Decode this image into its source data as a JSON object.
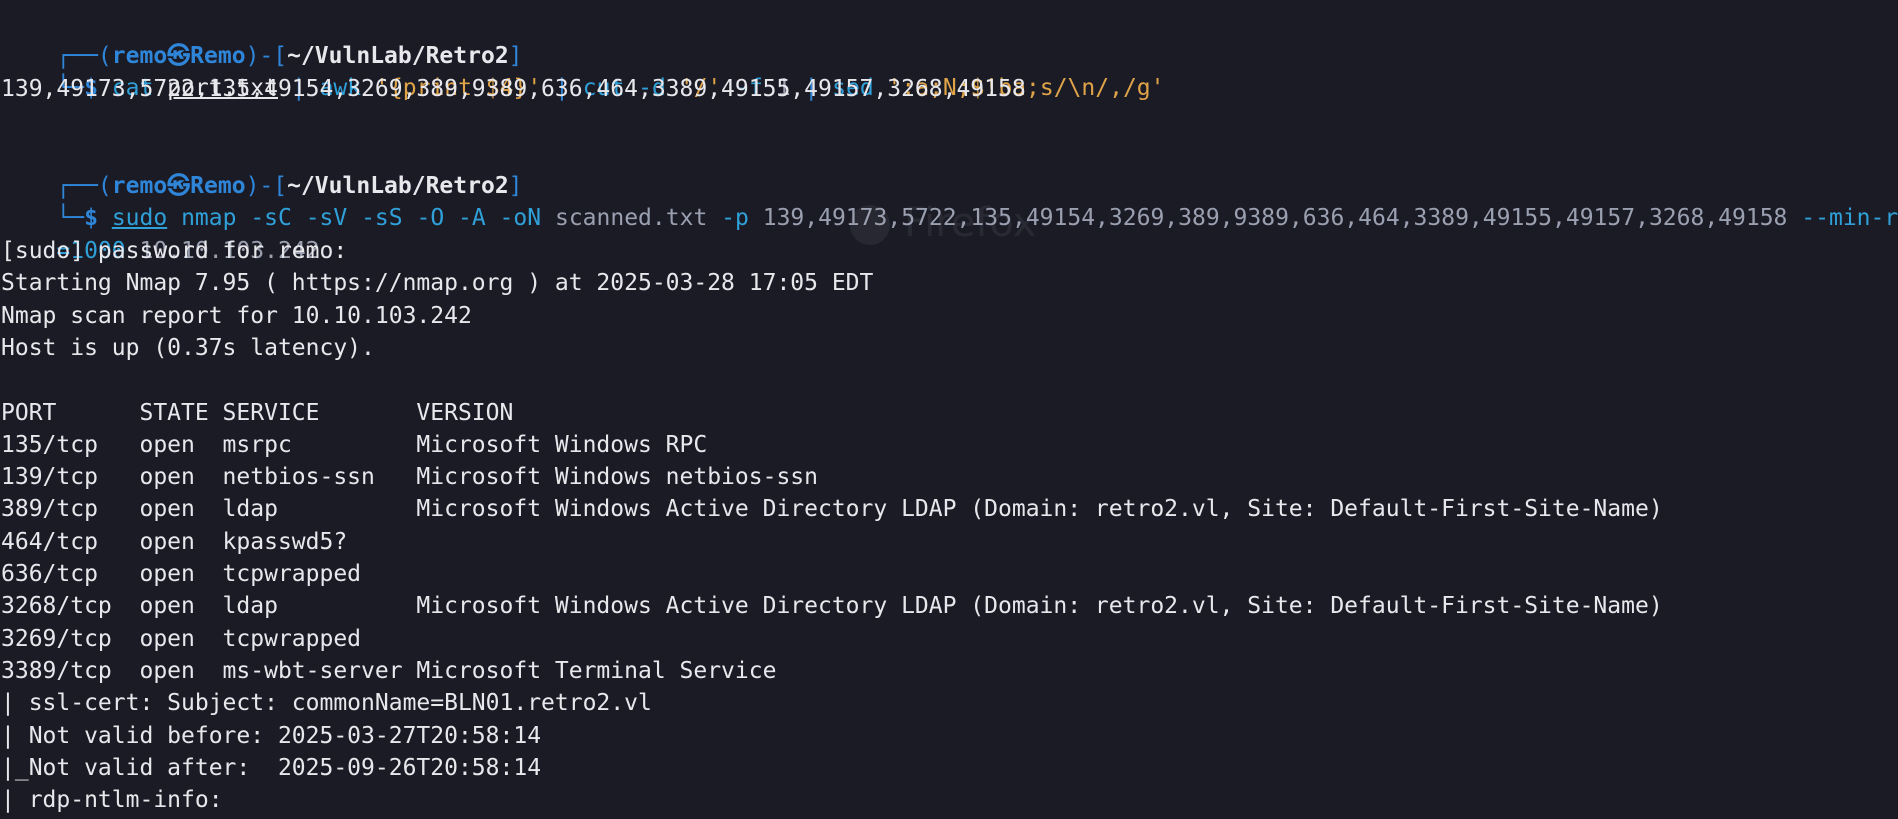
{
  "prompt": {
    "box_top": "┌──(",
    "user": "remo",
    "skull": "㉿",
    "host": "Remo",
    "sep": ")-[",
    "path": "~/VulnLab/Retro2",
    "close": "]",
    "box_bottom": "└─",
    "dollar": "$"
  },
  "cmd1": {
    "cat": "cat",
    "file": "port.txt",
    "pipe1": "|",
    "awk": "awk",
    "awk_open": "'",
    "awk_script": "{print $4}",
    "awk_close": "'",
    "pipe2": "|",
    "cut": "cut",
    "cut_opts": "-d",
    "cut_delim": "'/'",
    "cut_f": "-f",
    "cut_num": "1",
    "pipe3": "|",
    "sed": "sed",
    "sed_script": "':a;N;$!ba;s/\\n/,/g'"
  },
  "output1": "139,49173,5722,135,49154,3269,389,9389,636,464,3389,49155,49157,3268,49158",
  "cmd2": {
    "sudo": "sudo",
    "nmap": "nmap",
    "flags": "-sC -sV -sS -O -A -oN",
    "outfile": "scanned.txt",
    "p_flag": "-p",
    "ports": "139,49173,5722,135,49154,3269,389,9389,636,464,3389,49155,49157,3268,49158",
    "minrate": "--min-rate",
    "minrate_cont": "=1000",
    "target": "10.10.103.242"
  },
  "output2": [
    "[sudo] password for remo:",
    "Starting Nmap 7.95 ( https://nmap.org ) at 2025-03-28 17:05 EDT",
    "Nmap scan report for 10.10.103.242",
    "Host is up (0.37s latency).",
    "",
    "PORT      STATE SERVICE       VERSION",
    "135/tcp   open  msrpc         Microsoft Windows RPC",
    "139/tcp   open  netbios-ssn   Microsoft Windows netbios-ssn",
    "389/tcp   open  ldap          Microsoft Windows Active Directory LDAP (Domain: retro2.vl, Site: Default-First-Site-Name)",
    "464/tcp   open  kpasswd5?",
    "636/tcp   open  tcpwrapped",
    "3268/tcp  open  ldap          Microsoft Windows Active Directory LDAP (Domain: retro2.vl, Site: Default-First-Site-Name)",
    "3269/tcp  open  tcpwrapped",
    "3389/tcp  open  ms-wbt-server Microsoft Terminal Service",
    "| ssl-cert: Subject: commonName=BLN01.retro2.vl",
    "| Not valid before: 2025-03-27T20:58:14",
    "|_Not valid after:  2025-09-26T20:58:14",
    "| rdp-ntlm-info:"
  ],
  "watermark": "Firefox",
  "colors": {
    "background": "#1b1b26",
    "prompt_blue": "#2f86d8",
    "command_cyan": "#2fa0d8",
    "string_orange": "#e0a448",
    "text": "#e8e8ec"
  }
}
